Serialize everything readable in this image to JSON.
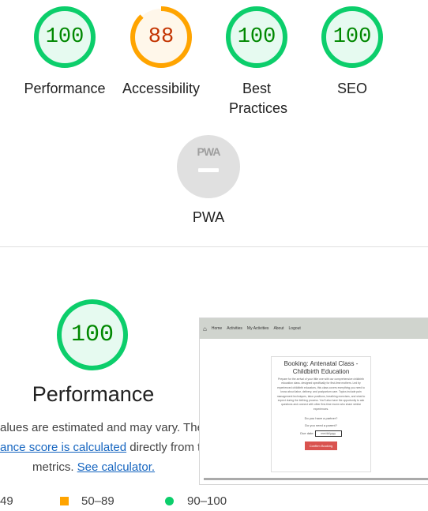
{
  "categories": [
    {
      "label": "Performance",
      "score": "100",
      "pct": 1.0,
      "status": "pass"
    },
    {
      "label": "Accessibility",
      "score": "88",
      "pct": 0.88,
      "status": "average"
    },
    {
      "label": "Best Practices",
      "score": "100",
      "pct": 1.0,
      "status": "pass"
    },
    {
      "label": "SEO",
      "score": "100",
      "pct": 1.0,
      "status": "pass"
    }
  ],
  "pwa": {
    "label": "PWA",
    "badge": "PWA"
  },
  "performance": {
    "score": "100",
    "title": "Performance",
    "desc_line1": "alues are estimated and may vary. The",
    "desc_link1": "ance score is calculated",
    "desc_line2_rest": " directly from th",
    "desc_line3_pre": "metrics. ",
    "desc_link2": "See calculator."
  },
  "legend": {
    "fail": "49",
    "average": "50–89",
    "pass": "90–100"
  },
  "screenshot": {
    "nav": [
      "Home",
      "Activities",
      "My Activities",
      "About",
      "Logout"
    ],
    "title": "Booking: Antenatal Class - Childbirth Education",
    "body": "Prepare for the arrival of your little one with our comprehensive childbirth education class. designed specifically for first-time mothers. Led by experienced childbirth educators, this class covers everything you need to know about labor, delivery, and postpartum care. Topics include pain management techniques, labor positions, breathing exercises, and what to expect during the birthing process. You'll also have the opportunity to ask questions and connect with other first-time mums who share similar experiences.",
    "q1": "Do you have a partner?",
    "q2": "Do you need a parent?",
    "date_label": "Due date:",
    "date_value": "mm/dd/yyyy",
    "button": "Confirm Booking"
  },
  "colors": {
    "pass": "#0cce6b",
    "pass_fill": "#e6faf0",
    "pass_text": "#008800",
    "average": "#ffa400",
    "average_fill": "#fff7ea",
    "average_text": "#c33300",
    "fail": "#ff4e42",
    "grey": "#dddddd"
  }
}
